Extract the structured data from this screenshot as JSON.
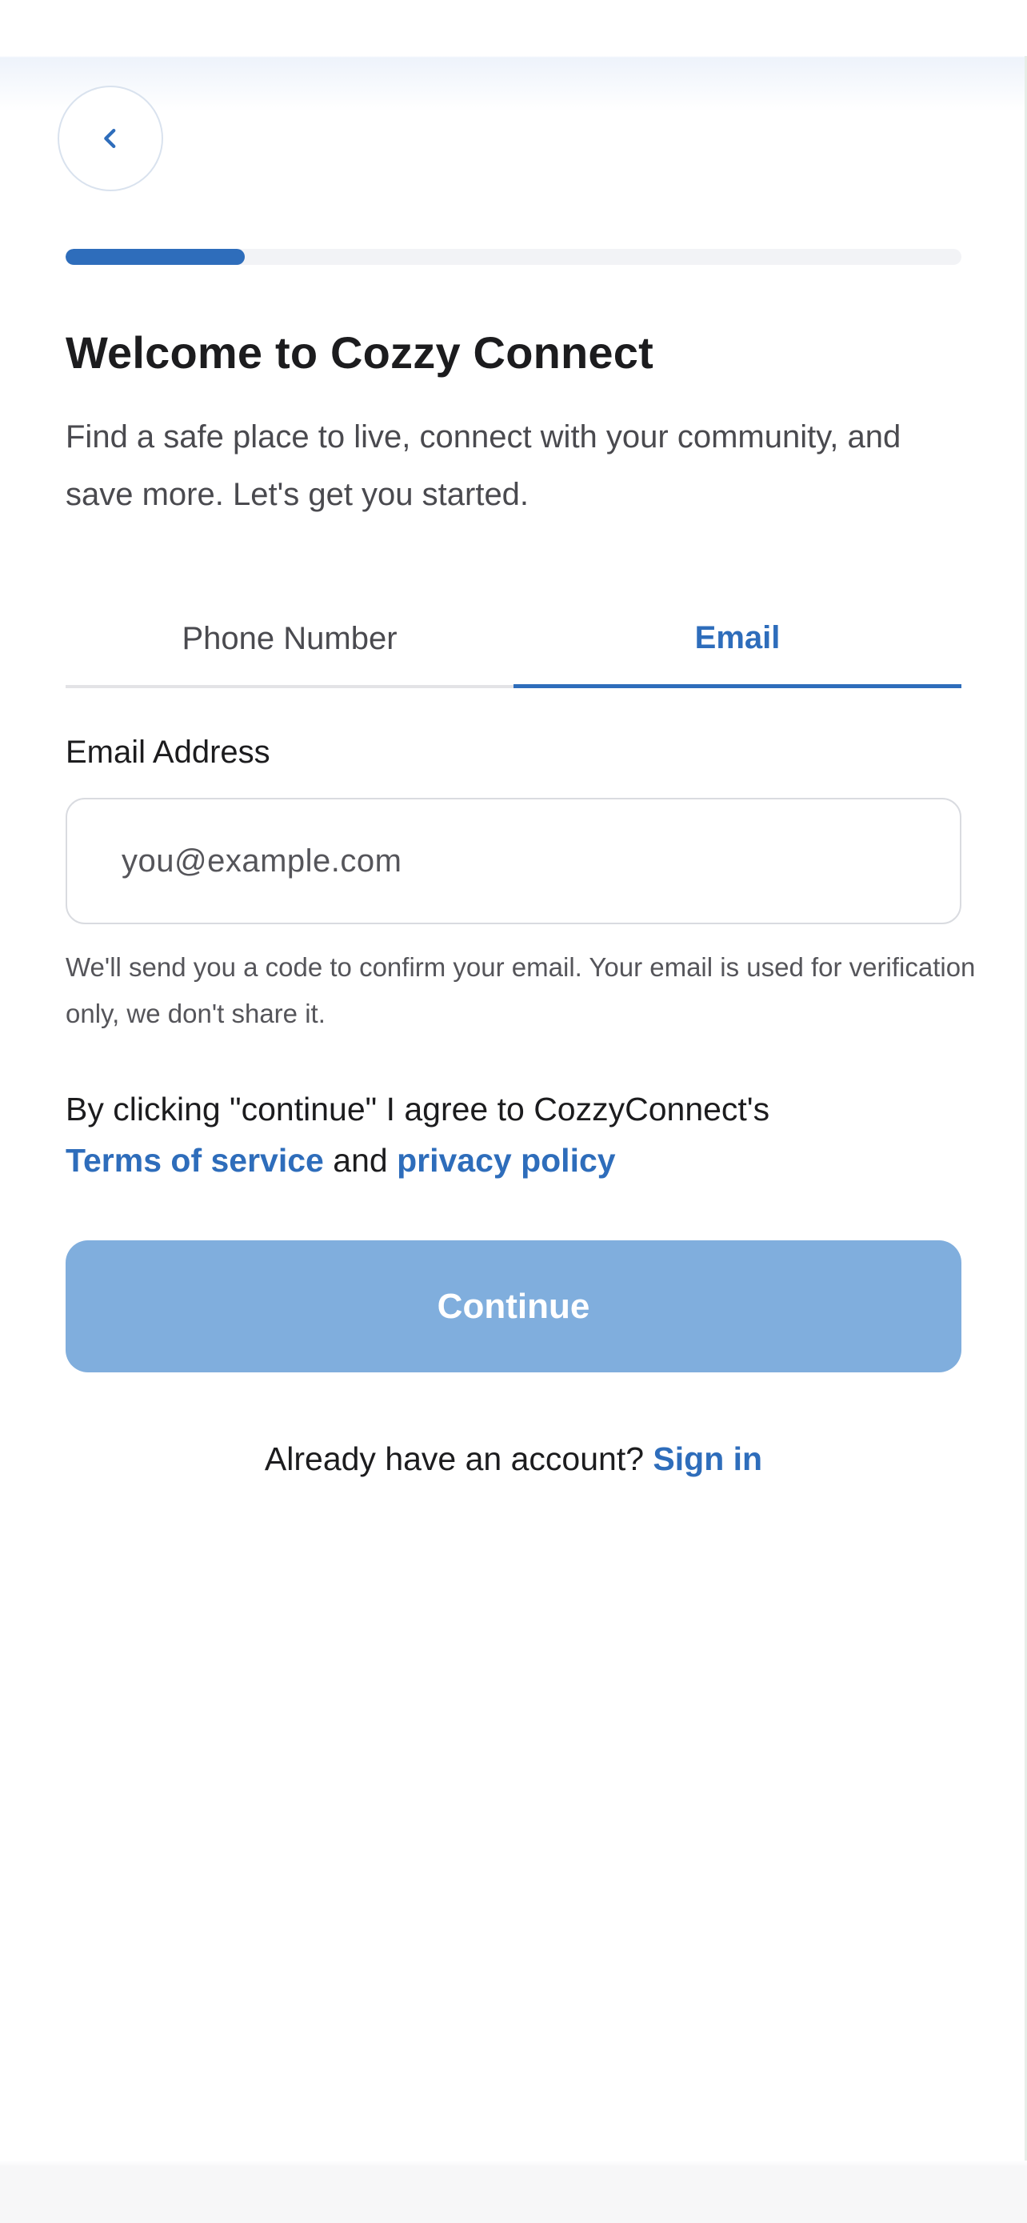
{
  "header": {
    "back_icon": "chevron-left-icon",
    "progress_percent": 20
  },
  "intro": {
    "title": "Welcome to Cozzy Connect",
    "subtitle": "Find a safe place to live, connect with your community, and save more. Let's get you started."
  },
  "tabs": [
    {
      "label": "Phone Number",
      "active": false
    },
    {
      "label": "Email",
      "active": true
    }
  ],
  "form": {
    "email_label": "Email Address",
    "email_value": "",
    "email_placeholder": "you@example.com",
    "helper_text": "We'll send you a code to confirm your email. Your email is used for verification only, we don't share it."
  },
  "agreement": {
    "prefix": "By clicking \"continue\" I agree to CozzyConnect's",
    "terms_link": "Terms of service",
    "conjunction": "and",
    "privacy_link": "privacy policy"
  },
  "actions": {
    "continue_label": "Continue"
  },
  "signin": {
    "prompt": "Already have an account?",
    "link": "Sign in"
  },
  "colors": {
    "accent": "#2e6dbb",
    "button_disabled": "#80aedd",
    "progress_track": "#f2f3f6"
  }
}
